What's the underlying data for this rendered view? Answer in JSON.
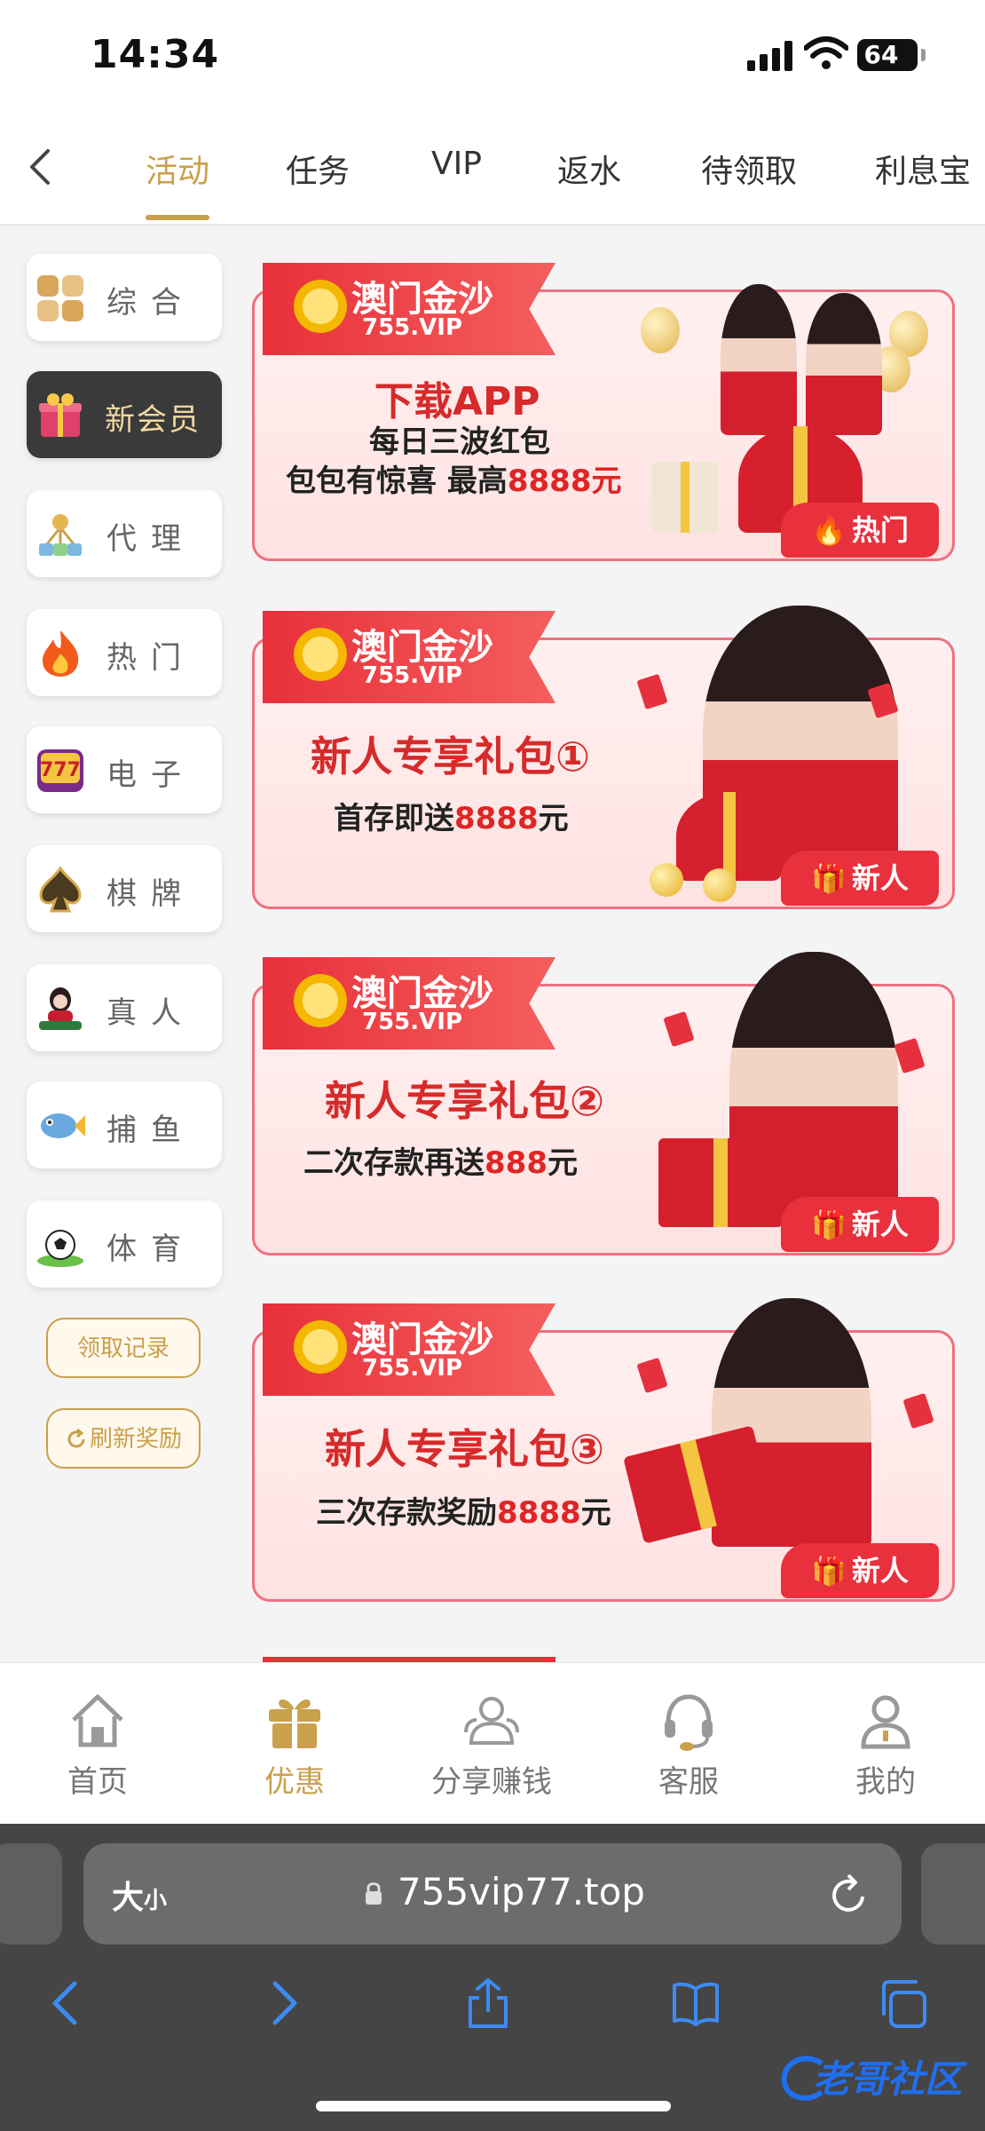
{
  "status_bar": {
    "time": "14:34",
    "battery": "64"
  },
  "tabs": [
    {
      "label": "活动",
      "active": true
    },
    {
      "label": "任务"
    },
    {
      "label": "VIP"
    },
    {
      "label": "返水"
    },
    {
      "label": "待领取"
    },
    {
      "label": "利息宝"
    }
  ],
  "sidebar": {
    "items": [
      {
        "label": "综合",
        "icon": "grid-icon"
      },
      {
        "label": "新会员",
        "icon": "gift-box-icon",
        "active": true
      },
      {
        "label": "代理",
        "icon": "agent-network-icon"
      },
      {
        "label": "热门",
        "icon": "flame-icon"
      },
      {
        "label": "电子",
        "icon": "slots-777-icon"
      },
      {
        "label": "棋牌",
        "icon": "spade-icon"
      },
      {
        "label": "真人",
        "icon": "live-dealer-icon"
      },
      {
        "label": "捕鱼",
        "icon": "fish-icon"
      },
      {
        "label": "体育",
        "icon": "soccer-ball-icon"
      }
    ],
    "record_button": "领取记录",
    "refresh_button": "刷新奖励"
  },
  "banners": [
    {
      "brand": "澳门金沙",
      "brand_sub": "755.VIP",
      "title": "下载APP",
      "line1": "每日三波红包",
      "line2_prefix": "包包有惊喜  最高",
      "line2_amount": "8888元",
      "badge": "热门",
      "badge_icon": "flame-icon"
    },
    {
      "brand": "澳门金沙",
      "brand_sub": "755.VIP",
      "title": "新人专享礼包①",
      "line_prefix": "首存即送",
      "line_amount": "8888",
      "line_suffix": "元",
      "badge": "新人",
      "badge_icon": "gift-icon"
    },
    {
      "brand": "澳门金沙",
      "brand_sub": "755.VIP",
      "title": "新人专享礼包②",
      "line_prefix": "二次存款再送",
      "line_amount": "888",
      "line_suffix": "元",
      "badge": "新人",
      "badge_icon": "gift-icon"
    },
    {
      "brand": "澳门金沙",
      "brand_sub": "755.VIP",
      "title": "新人专享礼包③",
      "line_prefix": "三次存款奖励",
      "line_amount": "8888",
      "line_suffix": "元",
      "badge": "新人",
      "badge_icon": "gift-icon"
    }
  ],
  "bottom_nav": [
    {
      "label": "首页",
      "icon": "home-icon"
    },
    {
      "label": "优惠",
      "icon": "gift-icon",
      "active": true
    },
    {
      "label": "分享赚钱",
      "icon": "share-users-icon"
    },
    {
      "label": "客服",
      "icon": "headset-icon"
    },
    {
      "label": "我的",
      "icon": "user-icon"
    }
  ],
  "browser": {
    "text_size": "大",
    "text_size_small": "小",
    "url": "755vip77.top"
  },
  "watermark": "老哥社区",
  "colors": {
    "accent": "#c9a04b",
    "banner_red": "#e8303a",
    "browser_bg": "#454545"
  }
}
